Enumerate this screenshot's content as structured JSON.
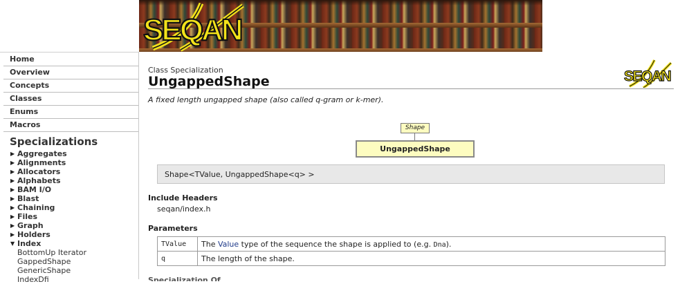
{
  "banner": {
    "logo_text": "SEQAN",
    "colors": {
      "logo_yellow": "#f2e21a",
      "logo_outline": "#111111"
    }
  },
  "sidebar": {
    "nav": [
      {
        "label": "Home"
      },
      {
        "label": "Overview"
      },
      {
        "label": "Concepts"
      },
      {
        "label": "Classes"
      },
      {
        "label": "Enums"
      },
      {
        "label": "Macros"
      }
    ],
    "specializations_heading": "Specializations",
    "items": [
      {
        "label": "Aggregates",
        "expanded": false
      },
      {
        "label": "Alignments",
        "expanded": false
      },
      {
        "label": "Allocators",
        "expanded": false
      },
      {
        "label": "Alphabets",
        "expanded": false
      },
      {
        "label": "BAM I/O",
        "expanded": false
      },
      {
        "label": "Blast",
        "expanded": false
      },
      {
        "label": "Chaining",
        "expanded": false
      },
      {
        "label": "Files",
        "expanded": false
      },
      {
        "label": "Graph",
        "expanded": false
      },
      {
        "label": "Holders",
        "expanded": false
      },
      {
        "label": "Index",
        "expanded": true
      }
    ],
    "index_children": [
      {
        "label": "BottomUp Iterator"
      },
      {
        "label": "GappedShape"
      },
      {
        "label": "GenericShape"
      },
      {
        "label": "IndexDfi"
      }
    ]
  },
  "main": {
    "kind": "Class Specialization",
    "title": "UngappedShape",
    "summary": "A fixed length ungapped shape (also called q-gram or k-mer).",
    "diagram": {
      "parent": "Shape",
      "self": "UngappedShape",
      "box_fill": "#fdfcc0"
    },
    "signature": "Shape<TValue, UngappedShape<q> >",
    "include_heading": "Include Headers",
    "include_value": "seqan/index.h",
    "params_heading": "Parameters",
    "params": [
      {
        "name": "TValue",
        "desc_prefix": "The ",
        "desc_link": "Value",
        "desc_middle": " type of the sequence the shape is applied to (e.g. ",
        "desc_code": "Dna",
        "desc_suffix": ")."
      },
      {
        "name": "q",
        "desc_prefix": "The length of the shape.",
        "desc_link": "",
        "desc_middle": "",
        "desc_code": "",
        "desc_suffix": ""
      }
    ],
    "next_heading_cut": "Specialization Of"
  }
}
